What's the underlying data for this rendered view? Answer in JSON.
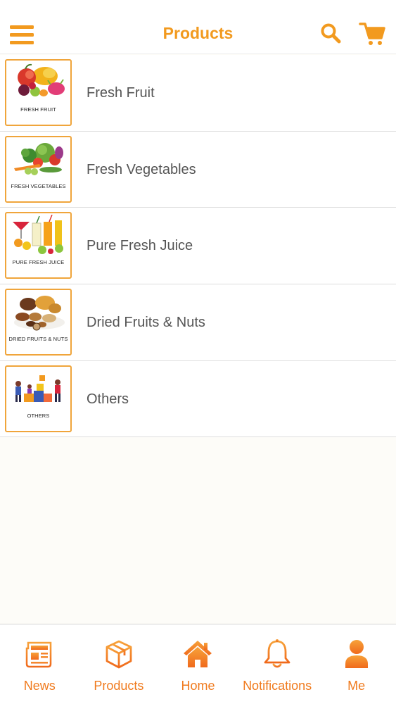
{
  "header": {
    "title": "Products",
    "menu_icon": "hamburger-menu-icon",
    "search_icon": "search-icon",
    "cart_icon": "shopping-cart-icon"
  },
  "categories": [
    {
      "label": "Fresh Fruit",
      "thumb_caption": "FRESH FRUIT"
    },
    {
      "label": "Fresh Vegetables",
      "thumb_caption": "FRESH VEGETABLES"
    },
    {
      "label": "Pure Fresh Juice",
      "thumb_caption": "PURE FRESH JUICE"
    },
    {
      "label": "Dried Fruits & Nuts",
      "thumb_caption": "DRIED FRUITS & NUTS"
    },
    {
      "label": "Others",
      "thumb_caption": "OTHERS"
    }
  ],
  "tabbar": {
    "items": [
      {
        "label": "News",
        "icon": "newspaper-icon"
      },
      {
        "label": "Products",
        "icon": "box-icon"
      },
      {
        "label": "Home",
        "icon": "home-icon"
      },
      {
        "label": "Notifications",
        "icon": "bell-icon"
      },
      {
        "label": "Me",
        "icon": "user-icon"
      }
    ]
  },
  "colors": {
    "accent": "#f29a1f",
    "tab_accent": "#f07a1d",
    "thumb_border": "#f0a53b",
    "row_text": "#555555",
    "background": "#fdfcf8"
  }
}
